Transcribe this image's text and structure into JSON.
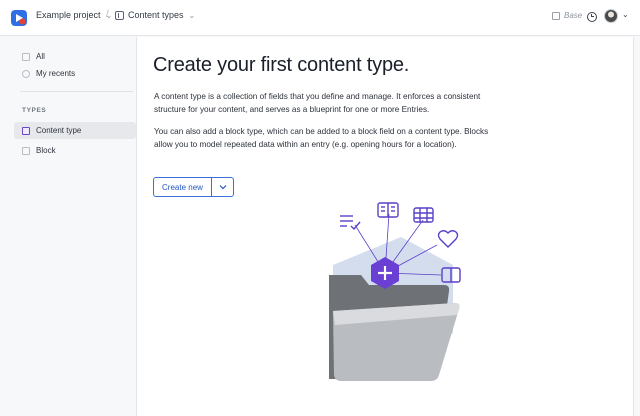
{
  "header": {
    "project": "Example project",
    "section": "Content types",
    "environment": "Base"
  },
  "sidebar": {
    "items": [
      {
        "label": "All",
        "icon": "grid-icon"
      },
      {
        "label": "My recents",
        "icon": "clock-icon"
      }
    ],
    "types_heading": "TYPES",
    "types": [
      {
        "label": "Content type",
        "icon": "content-type-icon",
        "active": true
      },
      {
        "label": "Block",
        "icon": "block-icon",
        "active": false
      }
    ]
  },
  "main": {
    "title": "Create your first content type.",
    "para1": "A content type is a collection of fields that you define and manage. It enforces a consistent structure for your content, and serves as a blueprint for one or more Entries.",
    "para2": "You can also add a block type, which can be added to a block field on a content type. Blocks allow you to model repeated data within an entry (e.g. opening hours for a location).",
    "create_button": "Create new"
  },
  "colors": {
    "accent": "#2456c4",
    "brand_purple": "#6a3fd4",
    "hex_background": "#cfd9ec"
  }
}
